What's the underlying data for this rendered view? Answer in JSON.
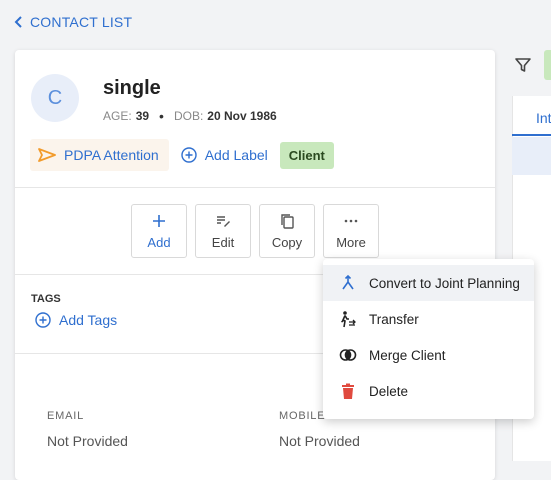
{
  "nav": {
    "back_label": "CONTACT LIST"
  },
  "profile": {
    "avatar_initial": "C",
    "name": "single",
    "age_label": "AGE:",
    "age_value": "39",
    "dob_label": "DOB:",
    "dob_value": "20 Nov 1986"
  },
  "labels": {
    "pdpa_label": "PDPA Attention",
    "add_label": "Add Label",
    "client_badge": "Client"
  },
  "actions": [
    {
      "label": "Add",
      "icon": "plus-icon"
    },
    {
      "label": "Edit",
      "icon": "edit-icon"
    },
    {
      "label": "Copy",
      "icon": "copy-icon"
    },
    {
      "label": "More",
      "icon": "more-icon"
    }
  ],
  "tags": {
    "title": "TAGS",
    "add_label": "Add Tags"
  },
  "fields": {
    "email_label": "EMAIL",
    "email_value": "Not Provided",
    "mobile_label": "MOBILE",
    "mobile_value": "Not Provided"
  },
  "right_panel": {
    "tab_label": "Int"
  },
  "more_menu": [
    {
      "label": "Convert to Joint Planning",
      "icon": "merge-arrows-icon"
    },
    {
      "label": "Transfer",
      "icon": "transfer-person-icon"
    },
    {
      "label": "Merge Client",
      "icon": "merge-circles-icon"
    },
    {
      "label": "Delete",
      "icon": "trash-icon"
    }
  ],
  "colors": {
    "accent": "#2f6fcf",
    "badge_green": "#c8e8bc",
    "delete_red": "#e04a3f",
    "pdpa_orange": "#f29b2b"
  }
}
